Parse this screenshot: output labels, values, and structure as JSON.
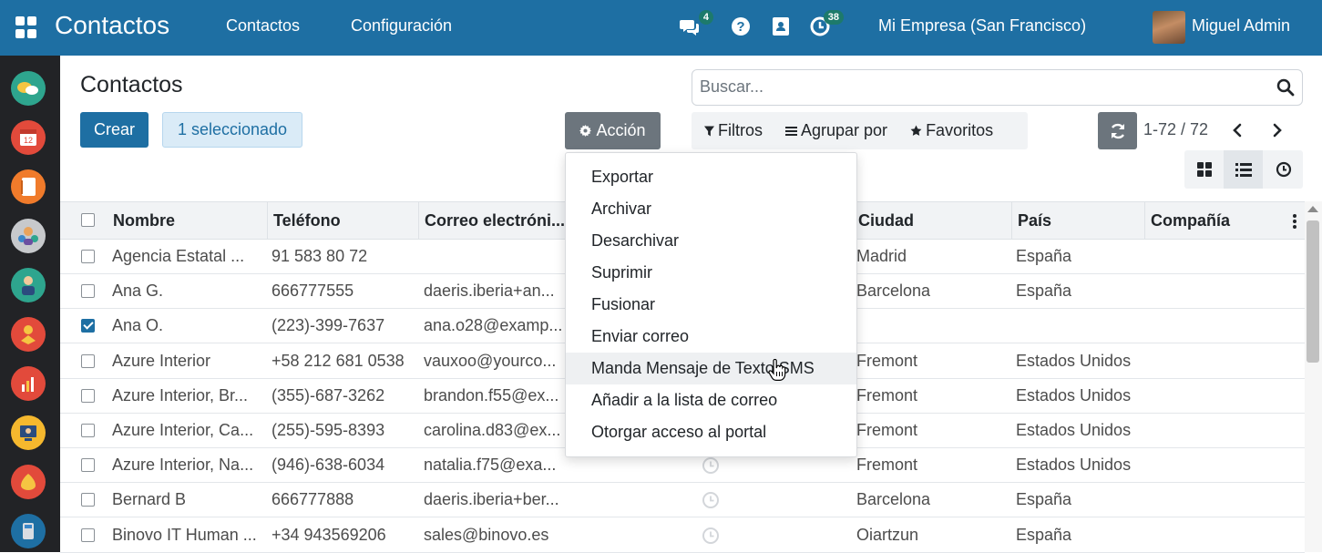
{
  "navbar": {
    "brand": "Contactos",
    "menu": [
      "Contactos",
      "Configuración"
    ],
    "messages_badge": "4",
    "activities_badge": "38",
    "company": "Mi Empresa (San Francisco)",
    "user": "Miguel Admin",
    "bar_color": "#1e6fa3"
  },
  "sidebar": {
    "apps": [
      "discuss-app",
      "calendar-app",
      "notes-app",
      "contacts-app",
      "employees-app",
      "crm-app",
      "sales-app",
      "website-app",
      "expenses-app",
      "pos-app"
    ]
  },
  "page": {
    "title": "Contactos",
    "create_label": "Crear",
    "selected_label": "1 seleccionado",
    "action_label": "Acción",
    "search_placeholder": "Buscar...",
    "filters_label": "Filtros",
    "group_by_label": "Agrupar por",
    "favorites_label": "Favoritos",
    "pager": "1-72 / 72"
  },
  "action_menu": {
    "items": [
      "Exportar",
      "Archivar",
      "Desarchivar",
      "Suprimir",
      "Fusionar",
      "Enviar correo",
      "Manda Mensaje de Texto SMS",
      "Añadir a la lista de correo",
      "Otorgar acceso al portal"
    ],
    "hovered": "Manda Mensaje de Texto SMS"
  },
  "table": {
    "columns": [
      "Nombre",
      "Teléfono",
      "Correo electróni...",
      "Ciudad",
      "País",
      "Compañía"
    ],
    "rows": [
      {
        "name": "Agencia Estatal ...",
        "phone": "91 583 80 72",
        "email": "",
        "city": "Madrid",
        "country": "España",
        "company": "",
        "checked": false
      },
      {
        "name": "Ana G.",
        "phone": "666777555",
        "email": "daeris.iberia+an...",
        "city": "Barcelona",
        "country": "España",
        "company": "",
        "checked": false
      },
      {
        "name": "Ana O.",
        "phone": "(223)-399-7637",
        "email": "ana.o28@examp...",
        "city": "",
        "country": "",
        "company": "",
        "checked": true
      },
      {
        "name": "Azure Interior",
        "phone": "+58 212 681 0538",
        "email": "vauxoo@yourco...",
        "city": "Fremont",
        "country": "Estados Unidos",
        "company": "",
        "checked": false
      },
      {
        "name": "Azure Interior, Br...",
        "phone": "(355)-687-3262",
        "email": "brandon.f55@ex...",
        "city": "Fremont",
        "country": "Estados Unidos",
        "company": "",
        "checked": false
      },
      {
        "name": "Azure Interior, Ca...",
        "phone": "(255)-595-8393",
        "email": "carolina.d83@ex...",
        "city": "Fremont",
        "country": "Estados Unidos",
        "company": "",
        "checked": false
      },
      {
        "name": "Azure Interior, Na...",
        "phone": "(946)-638-6034",
        "email": "natalia.f75@exa...",
        "city": "Fremont",
        "country": "Estados Unidos",
        "company": "",
        "checked": false
      },
      {
        "name": "Bernard B",
        "phone": "666777888",
        "email": "daeris.iberia+ber...",
        "city": "Barcelona",
        "country": "España",
        "company": "",
        "checked": false
      },
      {
        "name": "Binovo IT Human ...",
        "phone": "+34 943569206",
        "email": "sales@binovo.es",
        "city": "Oiartzun",
        "country": "España",
        "company": "",
        "checked": false
      }
    ]
  }
}
